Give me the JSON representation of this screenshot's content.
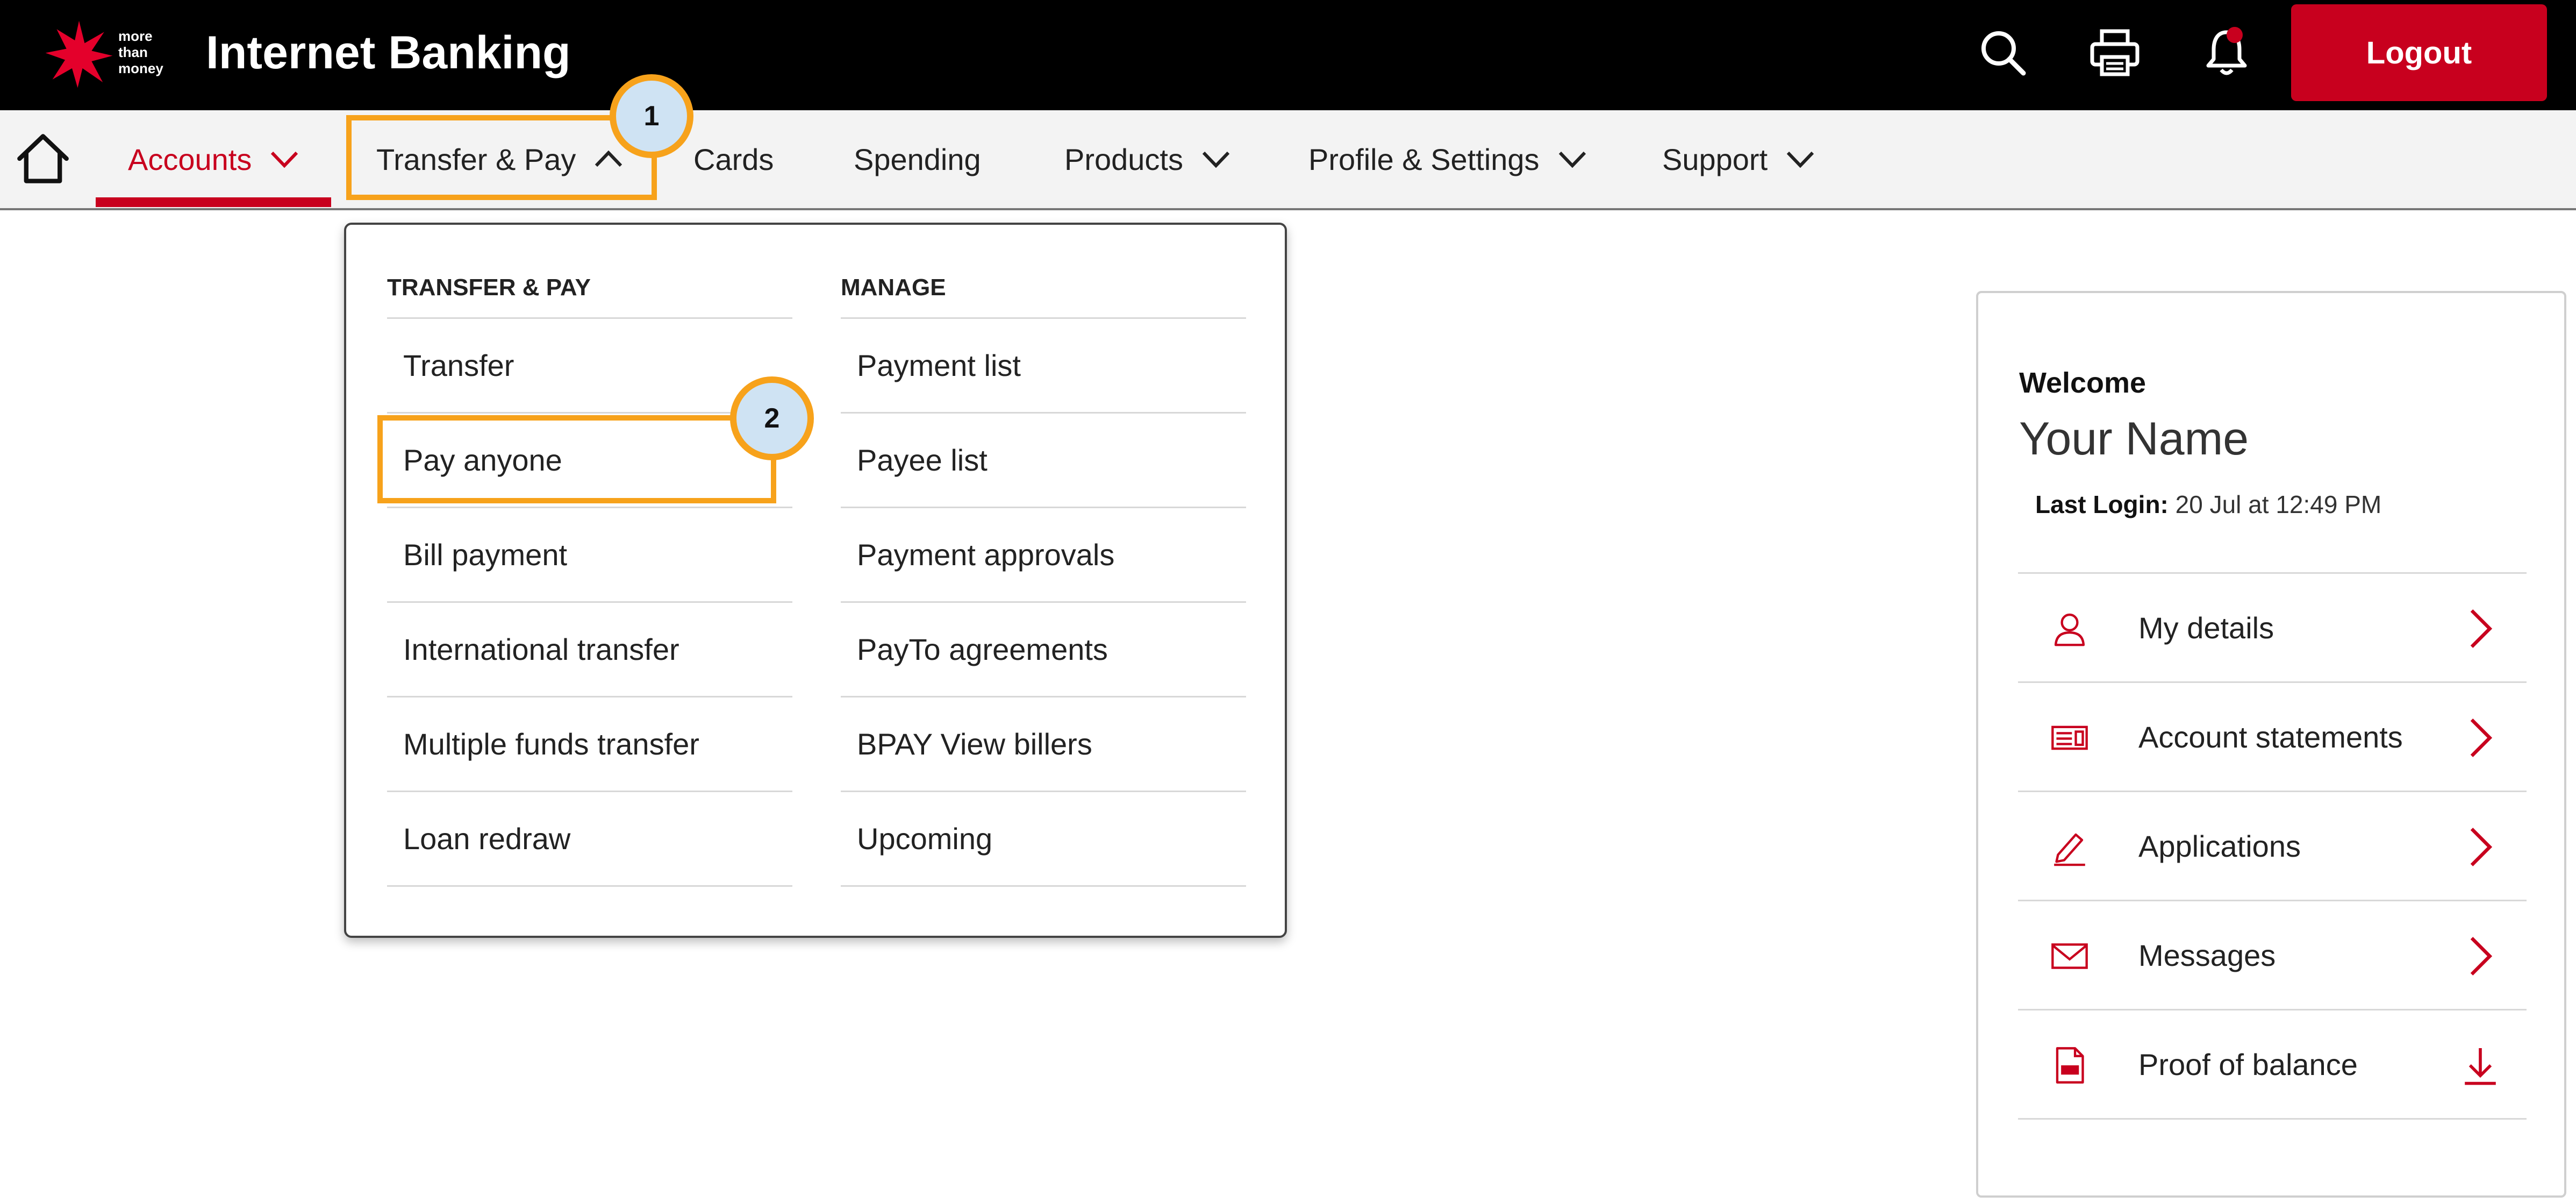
{
  "header": {
    "logo_tagline": [
      "more",
      "than",
      "money"
    ],
    "app_title": "Internet Banking",
    "logout_label": "Logout",
    "icons": [
      "search-icon",
      "print-icon",
      "bell-icon"
    ],
    "colors": {
      "brand_red": "#c8001e",
      "highlight_orange": "#f7a21b",
      "marker_fill": "#cfe3f3"
    }
  },
  "nav": {
    "items": [
      {
        "label": "Accounts",
        "active": true,
        "has_chevron": true
      },
      {
        "label": "Transfer & Pay",
        "expanded": true,
        "has_chevron": true
      },
      {
        "label": "Cards"
      },
      {
        "label": "Spending"
      },
      {
        "label": "Products",
        "has_chevron": true
      },
      {
        "label": "Profile & Settings",
        "has_chevron": true
      },
      {
        "label": "Support",
        "has_chevron": true
      }
    ]
  },
  "annotations": {
    "marker1": "1",
    "marker2": "2"
  },
  "dropdown": {
    "col1": {
      "heading": "TRANSFER & PAY",
      "items": [
        "Transfer",
        "Pay anyone",
        "Bill payment",
        "International transfer",
        "Multiple funds transfer",
        "Loan redraw"
      ]
    },
    "col2": {
      "heading": "MANAGE",
      "items": [
        "Payment list",
        "Payee list",
        "Payment approvals",
        "PayTo agreements",
        "BPAY View billers",
        "Upcoming"
      ]
    }
  },
  "welcome_panel": {
    "welcome": "Welcome",
    "name": "Your Name",
    "last_login_label": "Last Login:",
    "last_login_value": " 20 Jul at 12:49 PM",
    "items": [
      {
        "label": "My details",
        "icon": "person-icon",
        "action": "chevron-right-icon"
      },
      {
        "label": "Account statements",
        "icon": "statement-icon",
        "action": "chevron-right-icon"
      },
      {
        "label": "Applications",
        "icon": "pen-icon",
        "action": "chevron-right-icon"
      },
      {
        "label": "Messages",
        "icon": "envelope-icon",
        "action": "chevron-right-icon"
      },
      {
        "label": "Proof of balance",
        "icon": "pdf-icon",
        "action": "download-icon"
      }
    ]
  }
}
